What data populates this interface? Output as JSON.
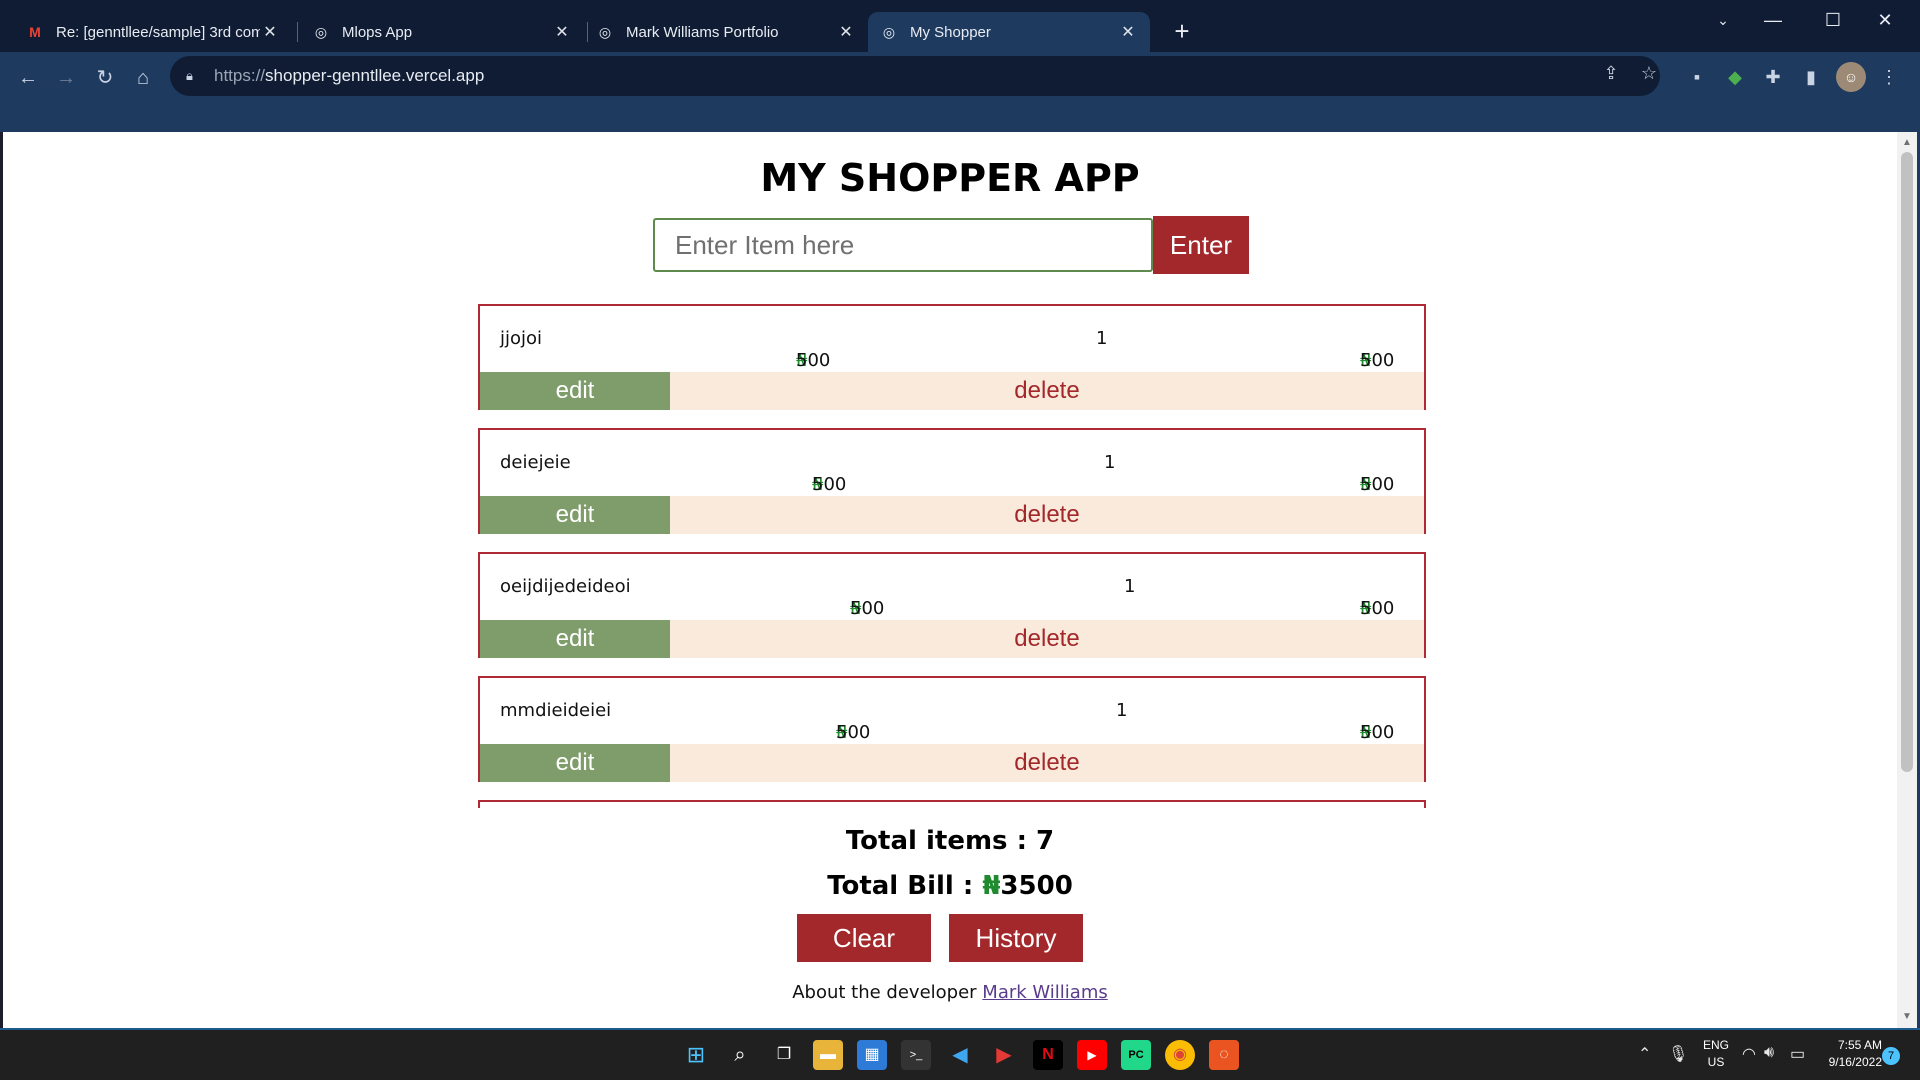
{
  "browser": {
    "tabs": [
      {
        "title": "Re: [genntllee/sample] 3rd comm",
        "favicon": "gmail-icon",
        "active": false
      },
      {
        "title": "Mlops App",
        "favicon": "globe-icon",
        "active": false
      },
      {
        "title": "Mark Williams Portfolio",
        "favicon": "globe-icon",
        "active": false
      },
      {
        "title": "My Shopper",
        "favicon": "globe-icon",
        "active": true
      }
    ],
    "url_protocol": "https://",
    "url_host": "shopper-genntllee.vercel.app"
  },
  "app": {
    "title": "MY SHOPPER APP",
    "input_placeholder": "Enter Item here",
    "enter_label": "Enter",
    "currency": "₦",
    "items": [
      {
        "name": "jjojoi",
        "price": "500",
        "qty": "1",
        "total": "500"
      },
      {
        "name": "deiejeie",
        "price": "500",
        "qty": "1",
        "total": "500"
      },
      {
        "name": "oeijdijedeideoi",
        "price": "500",
        "qty": "1",
        "total": "500"
      },
      {
        "name": "mmdieideiei",
        "price": "500",
        "qty": "1",
        "total": "500"
      }
    ],
    "edit_label": "edit",
    "delete_label": "delete",
    "total_items_label": "Total items : ",
    "total_items_value": "7",
    "total_bill_label": "Total Bill : ",
    "total_bill_value": "3500",
    "clear_label": "Clear",
    "history_label": "History",
    "footer_text": "About the developer ",
    "footer_link": "Mark Williams"
  },
  "taskbar": {
    "lang_line1": "ENG",
    "lang_line2": "US",
    "time": "7:55 AM",
    "date": "9/16/2022",
    "notification_count": "7"
  },
  "colors": {
    "accent_red": "#a3282b",
    "edit_green": "#7f9d6a",
    "naira_green": "#1f8a2e",
    "toolbar_blue": "#1e3a5f"
  }
}
